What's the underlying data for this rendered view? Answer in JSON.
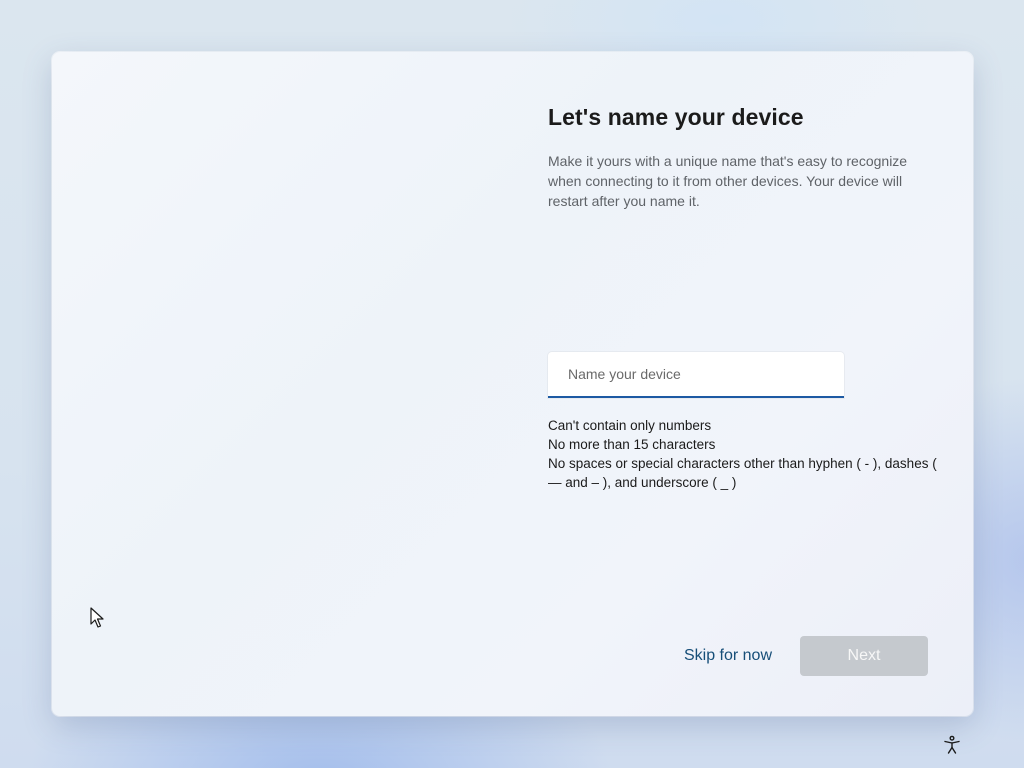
{
  "setup": {
    "title": "Let's name your device",
    "description": "Make it yours with a unique name that's easy to recognize when connecting to it from other devices. Your device will restart after you name it.",
    "device_name_input": {
      "value": "",
      "placeholder": "Name your device"
    },
    "rules": [
      "Can't contain only numbers",
      "No more than 15 characters",
      "No spaces or special characters other than hyphen ( - ), dashes ( — and – ), and underscore ( _ )"
    ]
  },
  "buttons": {
    "skip_label": "Skip for now",
    "next_label": "Next",
    "next_enabled": false
  },
  "icons": {
    "cursor": "mouse-pointer-icon",
    "accessibility": "accessibility-icon"
  },
  "colors": {
    "accent": "#1d5aa3",
    "link": "#164e78",
    "disabled_button": "#c5c9ce"
  }
}
